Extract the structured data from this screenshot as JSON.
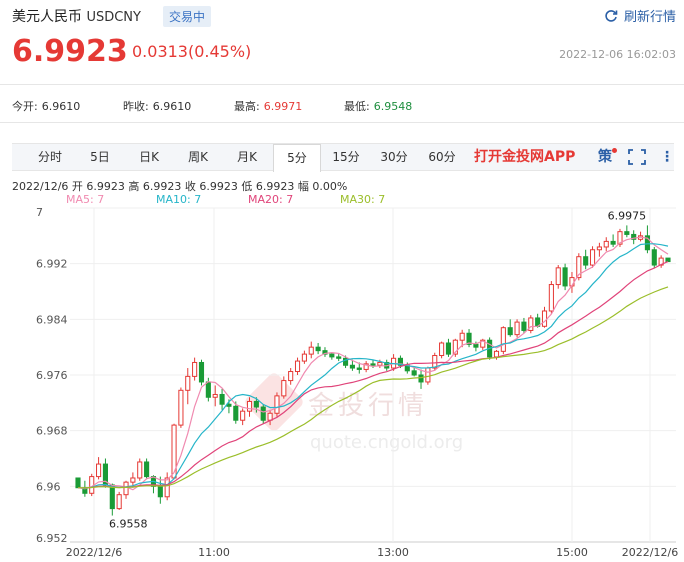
{
  "header": {
    "title": "美元人民币",
    "symbol": "USDCNY",
    "status": "交易中",
    "refresh": "刷新行情"
  },
  "quote": {
    "price": "6.9923",
    "change": "0.0313(0.45%)",
    "timestamp": "2022-12-06 16:02:03"
  },
  "stats": [
    {
      "label": "今开:",
      "value": "6.9610",
      "color": "#333"
    },
    {
      "label": "昨收:",
      "value": "6.9610",
      "color": "#333"
    },
    {
      "label": "最高:",
      "value": "6.9971",
      "color": "#e53935"
    },
    {
      "label": "最低:",
      "value": "6.9548",
      "color": "#1e8e3e"
    }
  ],
  "tabs": [
    "分时",
    "5日",
    "日K",
    "周K",
    "月K",
    "5分",
    "15分",
    "30分",
    "60分"
  ],
  "active_tab": "5分",
  "app_label": "打开金投网APP",
  "ohlc_line": "2022/12/6  开 6.9923  高 6.9923  收 6.9923  低 6.9923  幅 0.00%",
  "ma_labels": [
    {
      "text": "MA5: 7",
      "color": "#f08ab0"
    },
    {
      "text": "MA10: 7",
      "color": "#26b5c9"
    },
    {
      "text": "MA20: 7",
      "color": "#e0447a"
    },
    {
      "text": "MA30: 7",
      "color": "#9bbe2a"
    }
  ],
  "watermark": {
    "cn": "金投行情",
    "url": "quote.cngold.org"
  },
  "chart_data": {
    "type": "candlestick",
    "y_ticks": [
      "7",
      "6.992",
      "6.984",
      "6.976",
      "6.968",
      "6.96",
      "6.952"
    ],
    "x_labels": [
      "2022/12/6",
      "11:00",
      "13:00",
      "15:00",
      "2022/12/6"
    ],
    "ylim": [
      6.952,
      7.0
    ],
    "annotations": [
      {
        "text": "6.9975",
        "kind": "high"
      },
      {
        "text": "6.9558",
        "kind": "low"
      }
    ],
    "candles": [
      [
        6.9612,
        6.9612,
        6.9605,
        6.9598
      ],
      [
        6.9598,
        6.9608,
        6.9585,
        6.959
      ],
      [
        6.959,
        6.9618,
        6.9586,
        6.9614
      ],
      [
        6.9614,
        6.9642,
        6.961,
        6.9632
      ],
      [
        6.9632,
        6.964,
        6.9598,
        6.9602
      ],
      [
        6.9602,
        6.9604,
        6.9558,
        6.9568
      ],
      [
        6.9568,
        6.9592,
        6.9566,
        6.9588
      ],
      [
        6.9588,
        6.9608,
        6.9582,
        6.9606
      ],
      [
        6.9606,
        6.962,
        6.9598,
        6.9612
      ],
      [
        6.9612,
        6.964,
        6.9608,
        6.9635
      ],
      [
        6.9635,
        6.964,
        6.961,
        6.9614
      ],
      [
        6.9614,
        6.9616,
        6.959,
        6.96
      ],
      [
        6.96,
        6.9614,
        6.9575,
        6.9585
      ],
      [
        6.9585,
        6.962,
        6.958,
        6.9612
      ],
      [
        6.9612,
        6.969,
        6.961,
        6.9688
      ],
      [
        6.9688,
        6.9742,
        6.9684,
        6.9738
      ],
      [
        6.9738,
        6.977,
        6.9718,
        6.9758
      ],
      [
        6.9758,
        6.9785,
        6.9752,
        6.9778
      ],
      [
        6.9778,
        6.9782,
        6.9745,
        6.975
      ],
      [
        6.975,
        6.9756,
        6.9722,
        6.9728
      ],
      [
        6.9728,
        6.9745,
        6.9715,
        6.9732
      ],
      [
        6.9732,
        6.974,
        6.971,
        6.9718
      ],
      [
        6.9718,
        6.9725,
        6.9705,
        6.9715
      ],
      [
        6.9715,
        6.9722,
        6.969,
        6.9695
      ],
      [
        6.9695,
        6.9712,
        6.9688,
        6.9708
      ],
      [
        6.9708,
        6.9728,
        6.97,
        6.9722
      ],
      [
        6.9722,
        6.9728,
        6.9706,
        6.9714
      ],
      [
        6.9714,
        6.9718,
        6.969,
        6.9695
      ],
      [
        6.9695,
        6.971,
        6.9688,
        6.9705
      ],
      [
        6.9705,
        6.9735,
        6.97,
        6.973
      ],
      [
        6.973,
        6.9758,
        6.9726,
        6.9752
      ],
      [
        6.9752,
        6.977,
        6.9746,
        6.9765
      ],
      [
        6.9765,
        6.9785,
        6.976,
        6.978
      ],
      [
        6.978,
        6.9795,
        6.9776,
        6.979
      ],
      [
        6.979,
        6.9808,
        6.9784,
        6.98
      ],
      [
        6.98,
        6.9806,
        6.979,
        6.9795
      ],
      [
        6.9795,
        6.98,
        6.9786,
        6.979
      ],
      [
        6.979,
        6.9792,
        6.9782,
        6.9786
      ],
      [
        6.9786,
        6.979,
        6.978,
        6.9784
      ],
      [
        6.9784,
        6.9788,
        6.977,
        6.9774
      ],
      [
        6.9774,
        6.9782,
        6.9766,
        6.977
      ],
      [
        6.977,
        6.9778,
        6.9762,
        6.9768
      ],
      [
        6.9768,
        6.978,
        6.9764,
        6.9776
      ],
      [
        6.9776,
        6.9782,
        6.977,
        6.9774
      ],
      [
        6.9774,
        6.9782,
        6.977,
        6.9778
      ],
      [
        6.9778,
        6.9782,
        6.9766,
        6.977
      ],
      [
        6.977,
        6.979,
        6.9766,
        6.9784
      ],
      [
        6.9784,
        6.9788,
        6.977,
        6.9774
      ],
      [
        6.9774,
        6.9778,
        6.9762,
        6.9766
      ],
      [
        6.9766,
        6.977,
        6.9758,
        6.976
      ],
      [
        6.976,
        6.9768,
        6.974,
        6.975
      ],
      [
        6.975,
        6.9772,
        6.9746,
        6.977
      ],
      [
        6.977,
        6.9792,
        6.9766,
        6.9788
      ],
      [
        6.9788,
        6.9808,
        6.9784,
        6.9806
      ],
      [
        6.9806,
        6.9812,
        6.9786,
        6.979
      ],
      [
        6.979,
        6.9812,
        6.9786,
        6.981
      ],
      [
        6.981,
        6.9825,
        6.98,
        6.982
      ],
      [
        6.982,
        6.9826,
        6.98,
        6.9804
      ],
      [
        6.9804,
        6.9808,
        6.9794,
        6.98
      ],
      [
        6.98,
        6.9812,
        6.9796,
        6.981
      ],
      [
        6.981,
        6.9814,
        6.9782,
        6.9786
      ],
      [
        6.9786,
        6.9796,
        6.9782,
        6.9794
      ],
      [
        6.9794,
        6.983,
        6.979,
        6.9828
      ],
      [
        6.9828,
        6.984,
        6.9815,
        6.9818
      ],
      [
        6.9818,
        6.984,
        6.9814,
        6.9836
      ],
      [
        6.9836,
        6.9842,
        6.982,
        6.9824
      ],
      [
        6.9824,
        6.9846,
        6.982,
        6.9842
      ],
      [
        6.9842,
        6.9848,
        6.9828,
        6.983
      ],
      [
        6.983,
        6.9858,
        6.9828,
        6.9852
      ],
      [
        6.9852,
        6.9895,
        6.9848,
        6.989
      ],
      [
        6.989,
        6.9918,
        6.9884,
        6.9914
      ],
      [
        6.9914,
        6.992,
        6.9882,
        6.9888
      ],
      [
        6.9888,
        6.9908,
        6.9878,
        6.99
      ],
      [
        6.99,
        6.9935,
        6.9896,
        6.993
      ],
      [
        6.993,
        6.994,
        6.9912,
        6.9918
      ],
      [
        6.9918,
        6.9945,
        6.9914,
        6.994
      ],
      [
        6.994,
        6.995,
        6.993,
        6.9944
      ],
      [
        6.9944,
        6.9958,
        6.9938,
        6.9952
      ],
      [
        6.9952,
        6.9962,
        6.9944,
        6.9948
      ],
      [
        6.9948,
        6.997,
        6.9944,
        6.9966
      ],
      [
        6.9966,
        6.9975,
        6.9958,
        6.9962
      ],
      [
        6.9962,
        6.9968,
        6.9948,
        6.9955
      ],
      [
        6.9955,
        6.9966,
        6.9952,
        6.996
      ],
      [
        6.996,
        6.9975,
        6.9935,
        6.994
      ],
      [
        6.994,
        6.9944,
        6.9914,
        6.9918
      ],
      [
        6.9918,
        6.9932,
        6.9914,
        6.9928
      ],
      [
        6.9928,
        6.9928,
        6.9923,
        6.9923
      ]
    ]
  }
}
